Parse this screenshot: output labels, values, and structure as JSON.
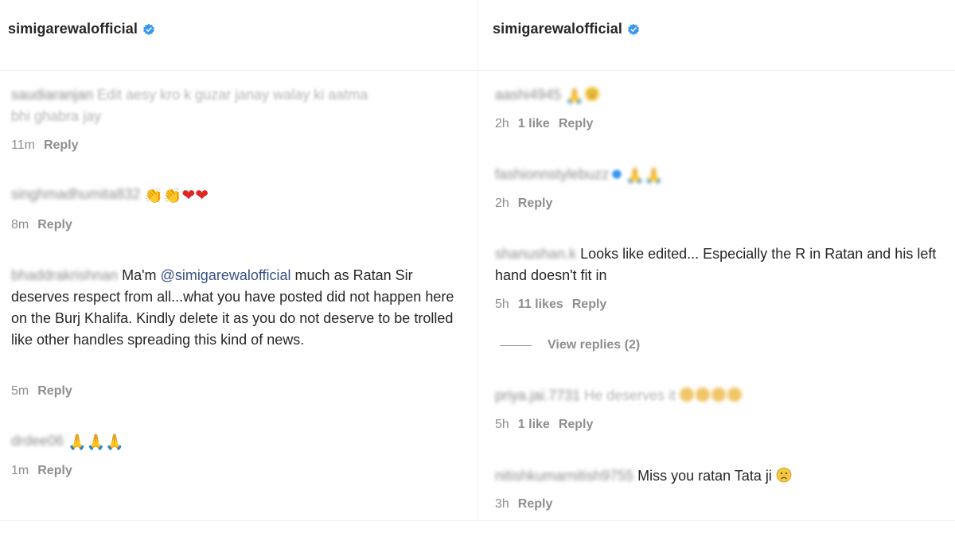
{
  "left": {
    "username": "simigarewalofficial",
    "comments": [
      {
        "user": "saudiaranjan",
        "text": "Edit aesy kro k guzar janay walay ki aatma",
        "text2": "bhi ghabra jay",
        "time": "11m",
        "reply": "Reply"
      },
      {
        "user": "singhmadhumita832",
        "time": "8m",
        "reply": "Reply"
      },
      {
        "user": "bhaddrakrishnan",
        "text_a": "Ma'm ",
        "mention": "@simigarewalofficial",
        "text_b": " much as Ratan Sir deserves respect from all...what you have posted did not happen here on the Burj Khalifa. Kindly delete it as you do not deserve to be trolled like other handles spreading this kind of news.",
        "time": "5m",
        "reply": "Reply"
      },
      {
        "user": "drdee06",
        "time": "1m",
        "reply": "Reply"
      }
    ]
  },
  "right": {
    "username": "simigarewalofficial",
    "comments": [
      {
        "user": "aashi4945",
        "time": "2h",
        "likes": "1 like",
        "reply": "Reply"
      },
      {
        "user": "fashionnstylebuzz",
        "time": "2h",
        "reply": "Reply"
      },
      {
        "user": "shanushan.k",
        "text": "Looks like edited... Especially the R in Ratan and his left hand doesn't fit in",
        "time": "5h",
        "likes": "11 likes",
        "reply": "Reply"
      },
      {
        "user": "priya.jai.7731",
        "text": "He deserves it",
        "time": "5h",
        "likes": "1 like",
        "reply": "Reply"
      },
      {
        "user": "nitishkumarnitish9755",
        "text": "Miss you ratan Tata ji",
        "time": "3h",
        "reply": "Reply"
      }
    ],
    "view_replies": "View replies (2)"
  },
  "icons": {
    "verified": "verified-badge-icon",
    "clap": "clapping-hands-icon",
    "heart": "red-heart-icon",
    "pray": "folded-hands-icon",
    "sad": "sad-face-icon"
  },
  "colors": {
    "verified": "#3897f0",
    "secondary_text": "#8e8e8e",
    "mention": "#385185"
  }
}
